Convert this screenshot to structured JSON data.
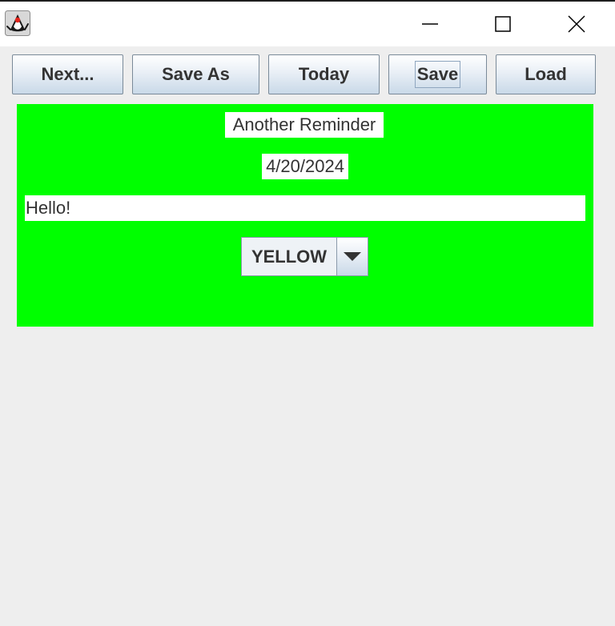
{
  "titlebar": {
    "app_icon": "java-duke-icon",
    "minimize_icon": "minimize-icon",
    "maximize_icon": "maximize-icon",
    "close_icon": "close-icon"
  },
  "toolbar": {
    "next_label": "Next...",
    "save_as_label": "Save As",
    "today_label": "Today",
    "save_label": "Save",
    "load_label": "Load"
  },
  "reminder": {
    "title": "Another Reminder",
    "date": "4/20/2024",
    "message": "Hello!",
    "color_selected": "YELLOW",
    "panel_color": "#00ff00"
  },
  "colors": {
    "window_background": "#eeeeee",
    "button_text": "#333333"
  }
}
